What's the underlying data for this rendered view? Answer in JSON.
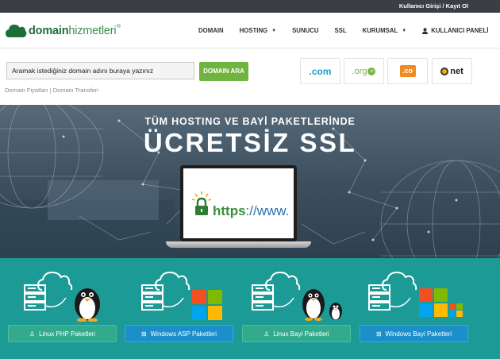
{
  "topbar": {
    "text": "Kullanıcı Girişi / Kayıt Ol"
  },
  "logo": {
    "part1": "domain",
    "part2": "hizmetleri",
    "reg": "®"
  },
  "nav": {
    "items": [
      {
        "label": "DOMAIN"
      },
      {
        "label": "HOSTING"
      },
      {
        "label": "SUNUCU"
      },
      {
        "label": "SSL"
      },
      {
        "label": "KURUMSAL"
      },
      {
        "label": "KULLANICI PANELİ"
      }
    ]
  },
  "search": {
    "value": "Aramak istediğiniz domain adını buraya yazınız",
    "button": "DOMAIN ARA",
    "links": "Domain Fiyatları | Domain Transferi"
  },
  "tlds": {
    "com": ".com",
    "org": ".org",
    "org_arrows": "»",
    "co": ".co",
    "net": "net"
  },
  "banner": {
    "subtitle": "TÜM HOSTING VE BAYİ PAKETLERİNDE",
    "title": "ÜCRETSİZ SSL",
    "https": "https",
    "www": "://www."
  },
  "products": [
    {
      "label": "Linux PHP Paketleri"
    },
    {
      "label": "Windows ASP Paketleri"
    },
    {
      "label": "Linux Bayi Paketleri"
    },
    {
      "label": "Windows Bayi Paketleri"
    }
  ],
  "colors": {
    "accent_green": "#6fb43e",
    "teal": "#1b9a96",
    "button_green": "#33aa8b",
    "button_blue": "#1c8fcb"
  }
}
